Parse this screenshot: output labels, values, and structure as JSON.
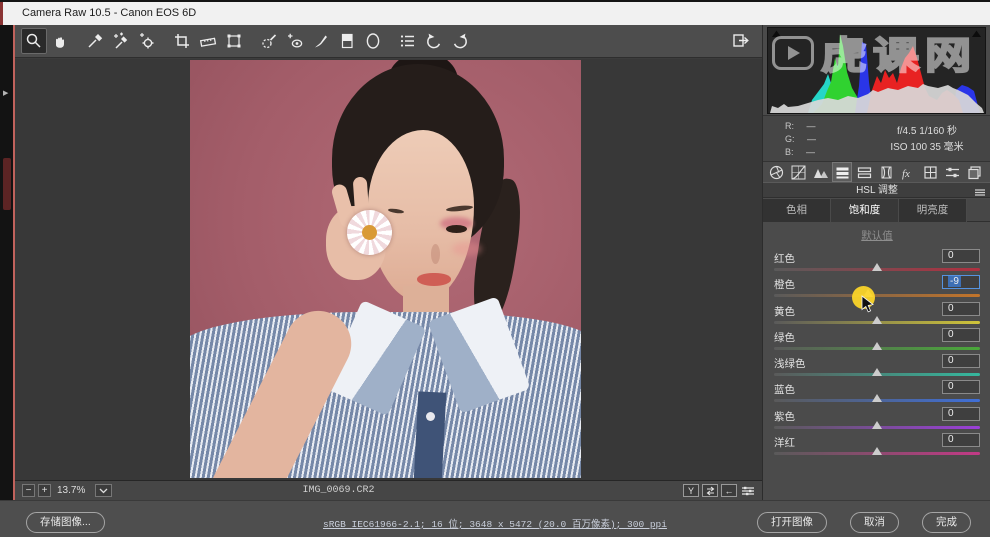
{
  "title_bar": {
    "title": "Camera Raw 10.5 -  Canon EOS 6D"
  },
  "toolbar": {
    "tools": [
      "zoom",
      "hand",
      "white-balance",
      "color-sampler",
      "targeted-adjustment",
      "crop",
      "straighten",
      "transform",
      "spot-removal",
      "red-eye",
      "adjustment-brush",
      "graduated-filter",
      "radial-filter",
      "preferences",
      "rotate-left",
      "rotate-right",
      "toggle-fullscreen"
    ],
    "selected_tool": "zoom"
  },
  "watermark": {
    "text": "虎课网"
  },
  "histogram": {
    "rgb": [
      {
        "label": "R:",
        "value": "—"
      },
      {
        "label": "G:",
        "value": "—"
      },
      {
        "label": "B:",
        "value": "—"
      }
    ],
    "exposure": "f/4.5  1/160 秒",
    "iso_line": "ISO 100   35 毫米"
  },
  "panel_icons": {
    "names": [
      "basic",
      "tone-curve",
      "detail",
      "hsl-grayscale",
      "split-toning",
      "lens-corrections",
      "effects",
      "camera-calibration",
      "presets",
      "snapshots"
    ],
    "selected": "hsl-grayscale",
    "fx_label": "fx"
  },
  "hsl": {
    "header": "HSL 调整",
    "tabs": [
      {
        "label": "色相"
      },
      {
        "label": "饱和度",
        "active": true
      },
      {
        "label": "明亮度"
      }
    ],
    "default_link": "默认值",
    "sliders": [
      {
        "label": "红色",
        "value": "0"
      },
      {
        "label": "橙色",
        "value": "-9",
        "editing": true
      },
      {
        "label": "黄色",
        "value": "0"
      },
      {
        "label": "绿色",
        "value": "0"
      },
      {
        "label": "浅绿色",
        "value": "0"
      },
      {
        "label": "蓝色",
        "value": "0"
      },
      {
        "label": "紫色",
        "value": "0"
      },
      {
        "label": "洋红",
        "value": "0"
      }
    ]
  },
  "canvas": {
    "filename": "IMG_0069.CR2",
    "zoom_level": "13.7%"
  },
  "glyphs": {
    "minus": "−",
    "plus": "+",
    "y_toggle": "Y",
    "left_arrow": "←",
    "mini_arrow": "▶"
  },
  "bottom_bar": {
    "save_button": "存储图像...",
    "workflow_link": "sRGB IEC61966-2.1; 16 位;  3648 x 5472 (20.0 百万像素); 300 ppi",
    "open_button": "打开图像",
    "cancel_button": "取消",
    "done_button": "完成"
  },
  "colors": {
    "accent_selection": "#3d6fb5",
    "cursor_highlight": "#ffd828",
    "canvas_bg": "#383838",
    "panel_bg": "#4b4b4b"
  }
}
